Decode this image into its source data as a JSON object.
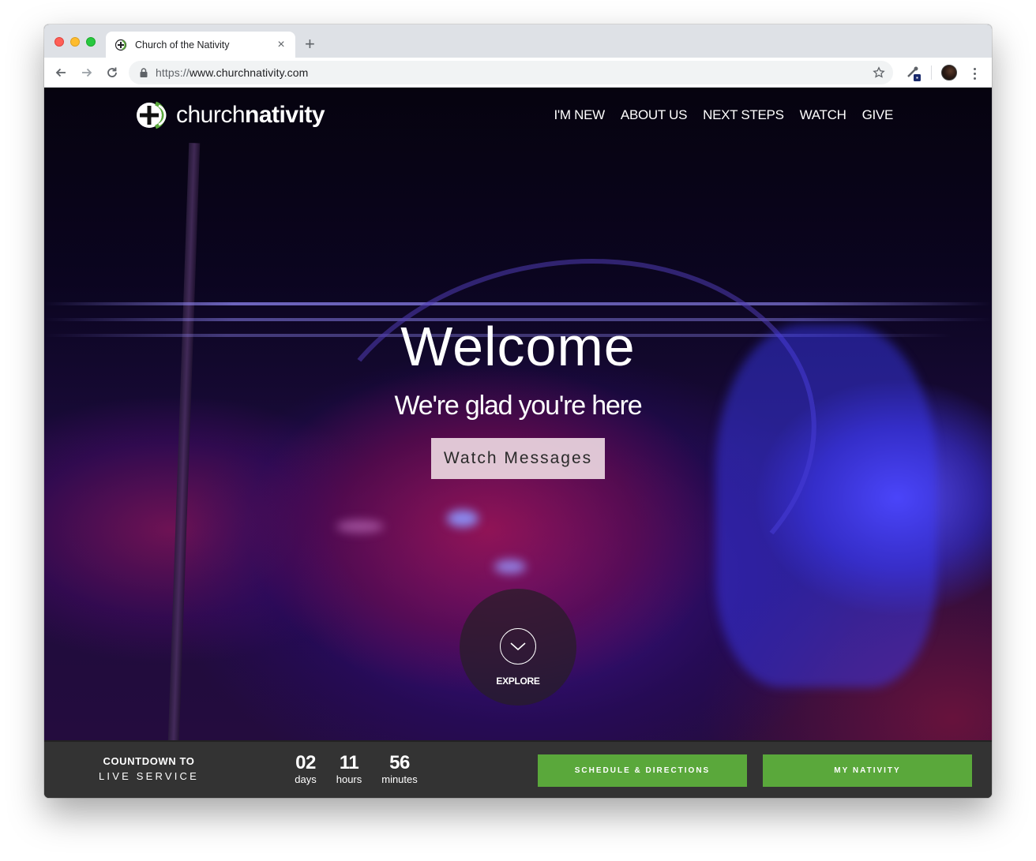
{
  "browser": {
    "tab_title": "Church of the Nativity",
    "new_tab_symbol": "+",
    "close_symbol": "×",
    "url_scheme": "https://",
    "url_host": "www.churchnativity.com"
  },
  "site": {
    "logo_light": "church",
    "logo_bold": "nativity",
    "nav": [
      "I'M NEW",
      "ABOUT US",
      "NEXT STEPS",
      "WATCH",
      "GIVE"
    ]
  },
  "hero": {
    "title": "Welcome",
    "tagline": "We're glad you're here",
    "cta_label": "Watch Messages",
    "explore_label": "EXPLORE"
  },
  "countdown": {
    "title_line1": "COUNTDOWN TO",
    "title_line2": "LIVE SERVICE",
    "days_value": "02",
    "days_label": "days",
    "hours_value": "11",
    "hours_label": "hours",
    "minutes_value": "56",
    "minutes_label": "minutes",
    "schedule_label": "SCHEDULE & DIRECTIONS",
    "my_nativity_label": "MY NATIVITY"
  },
  "colors": {
    "accent_green": "#5aa83b",
    "countdown_bg": "#333333",
    "cta_bg": "#ebd7e1"
  },
  "icons": [
    "back-arrow-icon",
    "forward-arrow-icon",
    "reload-icon",
    "lock-icon",
    "star-icon",
    "extension-icon",
    "profile-avatar",
    "more-vert-icon",
    "chevron-down-icon",
    "logo-mark"
  ]
}
